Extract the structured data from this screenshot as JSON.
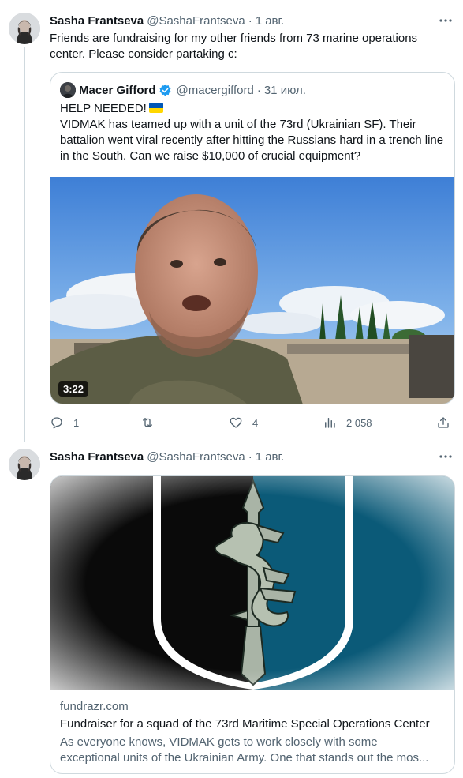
{
  "tweet1": {
    "author_name": "Sasha Frantseva",
    "author_handle": "@SashaFrantseva",
    "separator": "·",
    "date": "1 авг.",
    "text": "Friends are fundraising for my other friends from 73 marine operations center. Please consider partaking c:",
    "quote": {
      "author_name": "Macer Gifford",
      "author_handle": "@macergifford",
      "separator": "·",
      "date": "31 июл.",
      "text_line1": "HELP NEEDED!",
      "flag_icon": "ukraine-flag-icon",
      "text_rest": "VIDMAK has teamed up with a unit of the 73rd (Ukrainian SF). Their battalion went viral recently after hitting the Russians hard in a trench line in the South. Can we raise $10,000 of crucial equipment?",
      "video_duration": "3:22"
    },
    "actions": {
      "replies": "1",
      "retweets": "",
      "likes": "4",
      "views": "2 058"
    }
  },
  "tweet2": {
    "author_name": "Sasha Frantseva",
    "author_handle": "@SashaFrantseva",
    "separator": "·",
    "date": "1 авг.",
    "card": {
      "domain": "fundrazr.com",
      "title": "Fundraiser for a squad of the 73rd Maritime Special Operations Center",
      "description_line1": "As everyone knows, VIDMAK gets to work closely with some",
      "description_line2": "exceptional units of the Ukrainian Army. One that stands out the mos..."
    }
  },
  "colors": {
    "text_primary": "#0f1419",
    "text_secondary": "#536471",
    "border": "#cfd9de",
    "verified_blue": "#1d9bf0",
    "emblem_teal": "#0b5a78"
  }
}
